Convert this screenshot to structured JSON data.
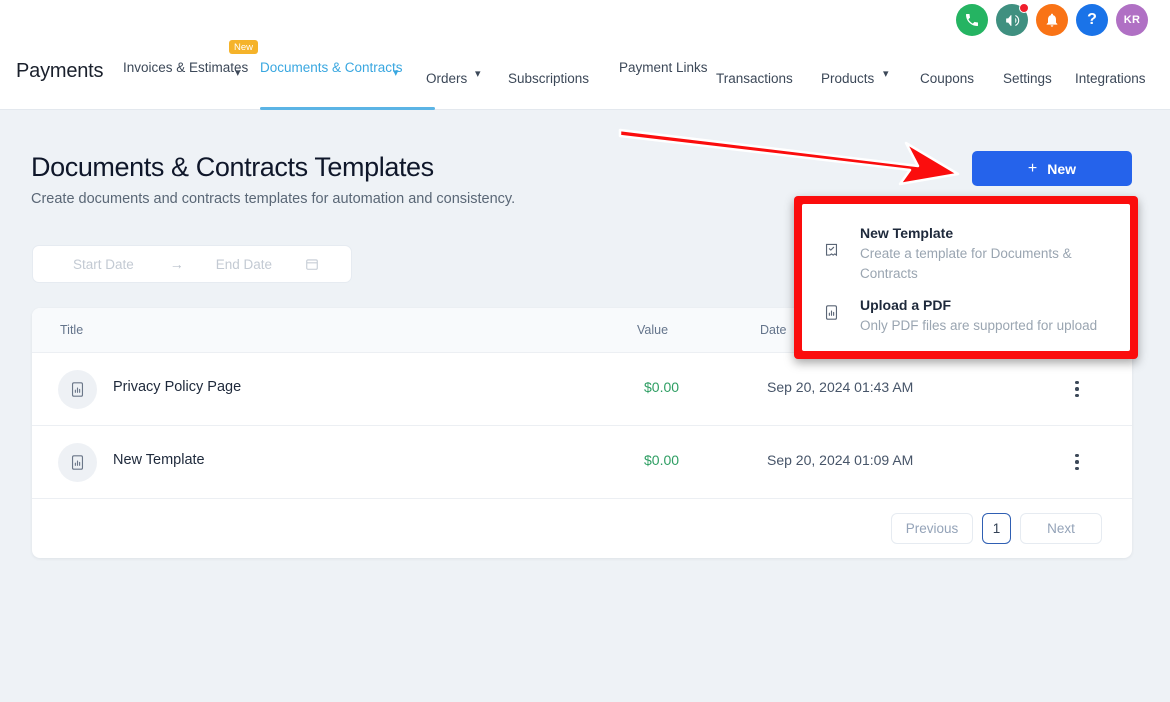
{
  "topbar": {
    "brand": "Payments",
    "util_icons": [
      {
        "name": "phone-icon",
        "glyph": "✆",
        "color": "#25b462"
      },
      {
        "name": "megaphone-icon",
        "glyph": "",
        "color": "#3f9080",
        "badge": true
      },
      {
        "name": "bell-icon",
        "glyph": "",
        "color": "#f97316"
      },
      {
        "name": "help-icon",
        "glyph": "?",
        "color": "#1a73e8"
      },
      {
        "name": "avatar",
        "glyph": "KR",
        "color": "#b070c4"
      }
    ],
    "nav": {
      "invoices": "Invoices & Estimates",
      "documents": "Documents & Contracts",
      "documents_badge": "New",
      "orders": "Orders",
      "subscriptions": "Subscriptions",
      "payment_links": "Payment Links",
      "transactions": "Transactions",
      "products": "Products",
      "coupons": "Coupons",
      "settings": "Settings",
      "integrations": "Integrations"
    }
  },
  "page": {
    "title": "Documents & Contracts Templates",
    "subtitle": "Create documents and contracts templates for automation and consistency.",
    "new_button": "New",
    "new_button_plus": "+"
  },
  "date_filter": {
    "start_placeholder": "Start Date",
    "end_placeholder": "End Date",
    "arrow": "→"
  },
  "table": {
    "headers": {
      "title": "Title",
      "value": "Value",
      "date": "Date"
    },
    "rows": [
      {
        "title": "Privacy Policy Page",
        "value": "$0.00",
        "date": "Sep 20, 2024 01:43 AM"
      },
      {
        "title": "New Template",
        "value": "$0.00",
        "date": "Sep 20, 2024 01:09 AM"
      }
    ]
  },
  "pagination": {
    "previous": "Previous",
    "page": "1",
    "next": "Next"
  },
  "dropdown": {
    "items": [
      {
        "title": "New Template",
        "desc": "Create a template for Documents & Contracts",
        "icon": "receipt-check-icon"
      },
      {
        "title": "Upload a PDF",
        "desc": "Only PDF files are supported for upload",
        "icon": "document-chart-icon"
      }
    ]
  },
  "colors": {
    "accent_blue": "#2563eb",
    "link_blue": "#39a7e0",
    "annotation_red": "#fb0d0d",
    "money_green": "#2e9e63",
    "badge_amber": "#f5b32a",
    "page_bg": "#eef2f6"
  }
}
